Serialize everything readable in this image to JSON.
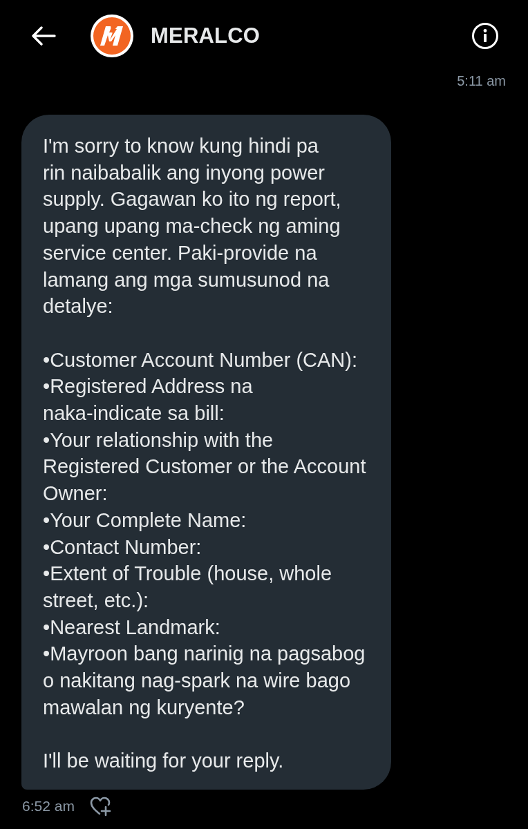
{
  "header": {
    "title": "MERALCO"
  },
  "previous_message": {
    "time": "5:11 am"
  },
  "message": {
    "intro": "I'm sorry to know kung hindi pa rin naibabalik ang inyong power supply. Gagawan ko ito ng report, upang upang ma-check ng aming service center. Paki-provide na lamang ang mga sumusunod na detalye:",
    "items": [
      "•Customer Account Number (CAN):",
      "•Registered Address na naka-indicate sa bill:",
      "•Your relationship with the Registered Customer or the Account Owner:",
      "•Your Complete Name:",
      "•Contact Number:",
      "•Extent of Trouble (house, whole street, etc.):",
      "•Nearest Landmark:",
      "•Mayroon bang narinig na pagsabog o nakitang nag-spark na wire bago mawalan ng kuryente?"
    ],
    "closing": "I'll be waiting for your reply.",
    "time": "6:52 am"
  }
}
